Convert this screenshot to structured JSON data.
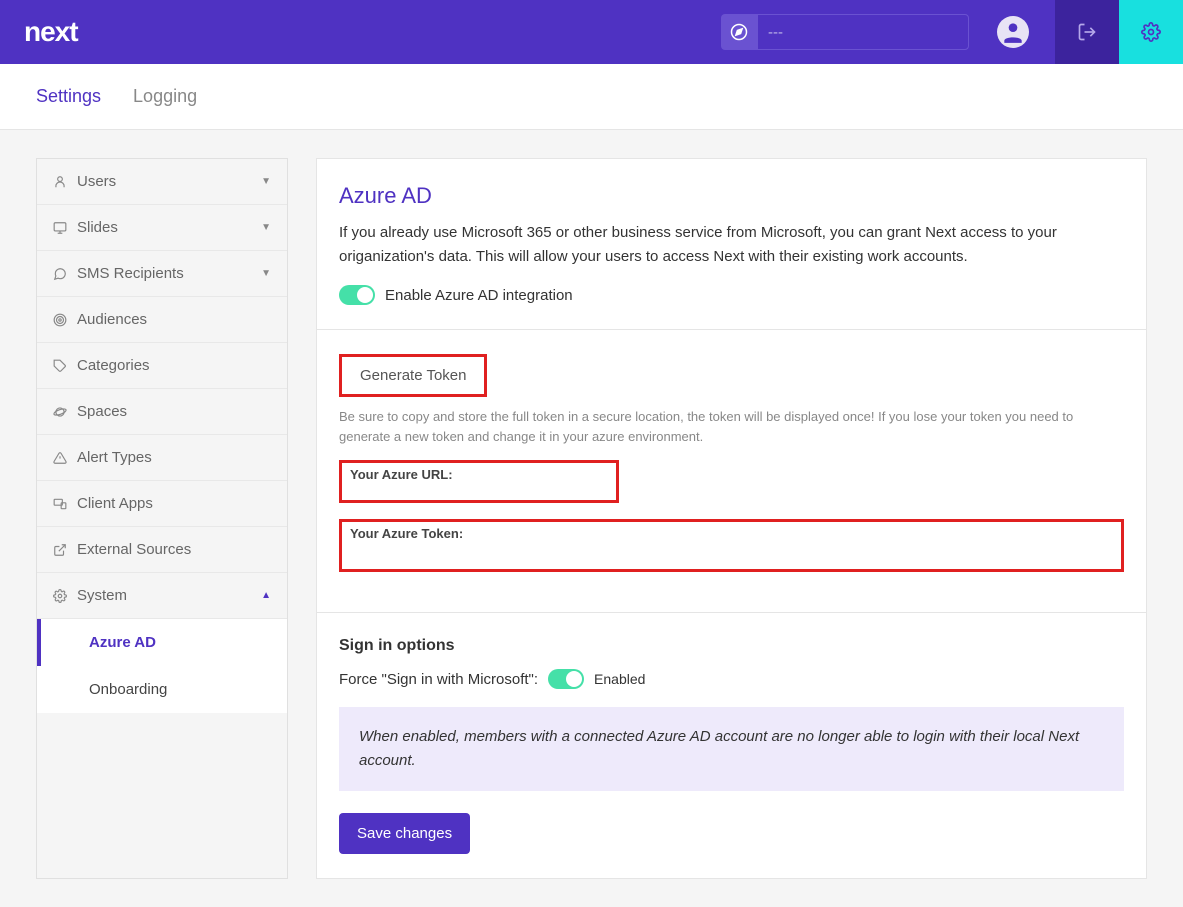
{
  "header": {
    "logo": "next",
    "search_value": "---"
  },
  "tabs": {
    "settings": "Settings",
    "logging": "Logging"
  },
  "sidebar": {
    "items": [
      {
        "label": "Users"
      },
      {
        "label": "Slides"
      },
      {
        "label": "SMS Recipients"
      },
      {
        "label": "Audiences"
      },
      {
        "label": "Categories"
      },
      {
        "label": "Spaces"
      },
      {
        "label": "Alert Types"
      },
      {
        "label": "Client Apps"
      },
      {
        "label": "External Sources"
      },
      {
        "label": "System"
      }
    ],
    "system_sub": [
      {
        "label": "Azure AD"
      },
      {
        "label": "Onboarding"
      }
    ]
  },
  "azure": {
    "title": "Azure AD",
    "desc": "If you already use Microsoft 365 or other business service from Microsoft, you can grant Next access to your origanization's data. This will allow your users to access Next with their existing work accounts.",
    "enable_label": "Enable Azure AD integration",
    "generate_btn": "Generate Token",
    "token_hint": "Be sure to copy and store the full token in a secure location, the token will be displayed once! If you lose your token you need to generate a new token and change it in your azure environment.",
    "url_label": "Your Azure URL:",
    "token_label": "Your Azure Token:"
  },
  "signin": {
    "title": "Sign in options",
    "force_label": "Force \"Sign in with Microsoft\":",
    "enabled": "Enabled",
    "info": "When enabled, members with a connected Azure AD account are no longer able to login with their local Next account.",
    "save": "Save changes"
  }
}
